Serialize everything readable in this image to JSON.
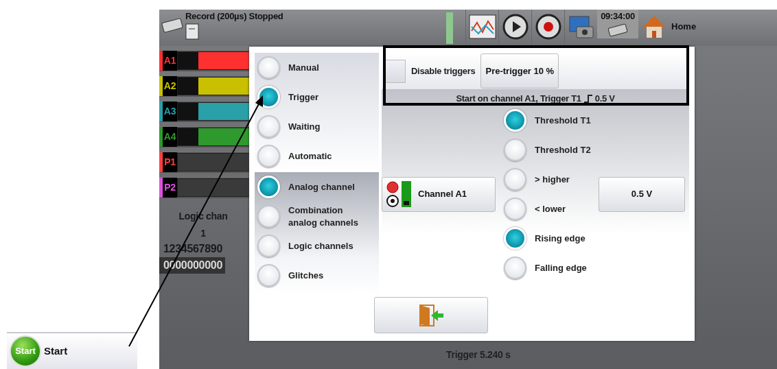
{
  "header": {
    "status": "Record (200µs) Stopped",
    "time": "09:34:00",
    "home": "Home"
  },
  "channels": [
    {
      "label": "A1",
      "color": "#ff3030",
      "kind": "analog"
    },
    {
      "label": "A2",
      "color": "#c8c000",
      "kind": "analog"
    },
    {
      "label": "A3",
      "color": "#2aa0a8",
      "kind": "analog"
    },
    {
      "label": "A4",
      "color": "#2e9a2e",
      "kind": "analog"
    },
    {
      "label": "P1",
      "color": "#ff4040",
      "kind": "logic"
    },
    {
      "label": "P2",
      "color": "#e050e0",
      "kind": "logic"
    }
  ],
  "background": {
    "logic_title": "Logic chan",
    "logic_index": "1",
    "logic_digits": "1234567890",
    "logic_values": "0000000000",
    "trigger_time": "Trigger  5.240 s"
  },
  "dialog": {
    "modes": [
      {
        "label": "Manual",
        "selected": false
      },
      {
        "label": "Trigger",
        "selected": true
      },
      {
        "label": "Waiting",
        "selected": false
      },
      {
        "label": "Automatic",
        "selected": false
      }
    ],
    "sources": [
      {
        "label": "Analog channel",
        "selected": true
      },
      {
        "label": "Combination analog channels",
        "selected": false
      },
      {
        "label": "Logic channels",
        "selected": false
      },
      {
        "label": "Glitches",
        "selected": false
      }
    ],
    "disable_triggers": {
      "label": "Disable triggers",
      "checked": false
    },
    "pretrigger": "Pre-trigger 10 %",
    "summary": "Start on channel A1, Trigger T1",
    "summary_value": "0.5 V",
    "channel_button": "Channel A1",
    "thresholds": [
      {
        "label": "Threshold T1",
        "selected": true
      },
      {
        "label": "Threshold T2",
        "selected": false
      }
    ],
    "conditions": [
      {
        "label": "> higher",
        "selected": false
      },
      {
        "label": "< lower",
        "selected": false
      },
      {
        "label": "Rising edge",
        "selected": true
      },
      {
        "label": "Falling edge",
        "selected": false
      }
    ],
    "value_button": "0.5 V"
  },
  "callout": {
    "button": "Start",
    "icon_text": "Start"
  }
}
